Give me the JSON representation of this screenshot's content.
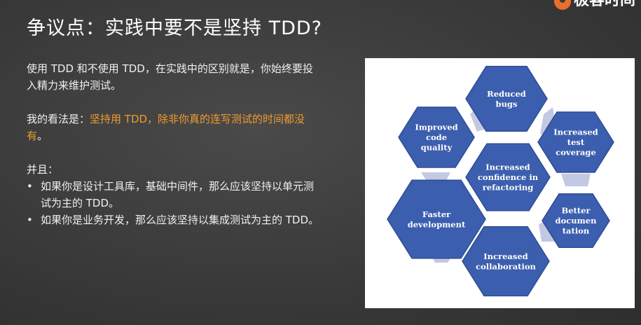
{
  "slide": {
    "title": "争议点：实践中要不是坚持 TDD?",
    "logo_text": "极客时间",
    "para1": "使用 TDD 和不使用 TDD，在实践中的区别就是，你始终要投入精力来维护测试。",
    "para2_prefix": "我的看法是：",
    "para2_highlight": "坚持用 TDD，除非你真的连写测试的时间都没有",
    "para2_suffix": "。",
    "and_label": "并且：",
    "bullets": [
      "如果你是设计工具库，基础中间件，那么应该坚持以单元测试为主的 TDD。",
      "如果你是业务开发，那么应该坚持以集成测试为主的 TDD。"
    ]
  },
  "diagram": {
    "hexagons": {
      "reduced_bugs": [
        "Reduced",
        "bugs"
      ],
      "improved_quality": [
        "Improved",
        "code",
        "quality"
      ],
      "increased_coverage": [
        "Increased",
        "test",
        "coverage"
      ],
      "center": [
        "Increased",
        "confidence in",
        "refactoring"
      ],
      "faster_dev": [
        "Faster",
        "development"
      ],
      "better_docs": [
        "Better",
        "documen",
        "tation"
      ],
      "collaboration": [
        "Increased",
        "collaboration"
      ]
    },
    "colors": {
      "hex_fill": "#3c5eae",
      "hex_stroke": "#2f4d94",
      "connector": "#c3c9e3"
    }
  }
}
